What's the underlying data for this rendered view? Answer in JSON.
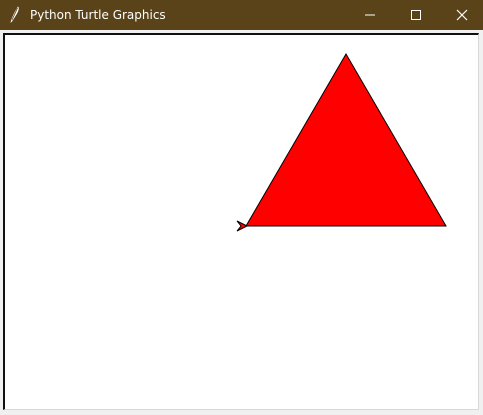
{
  "window": {
    "title": "Python Turtle Graphics",
    "titlebar_color": "#5a4319",
    "controls": {
      "minimize_icon": "minimize-icon",
      "maximize_icon": "maximize-icon",
      "close_icon": "close-icon"
    }
  },
  "canvas": {
    "background": "#ffffff",
    "shape": "triangle",
    "fill_color": "#ff0000",
    "stroke_color": "#000000",
    "turtle_icon": "turtle-arrow-icon",
    "turtle_color": "#ff0000"
  }
}
